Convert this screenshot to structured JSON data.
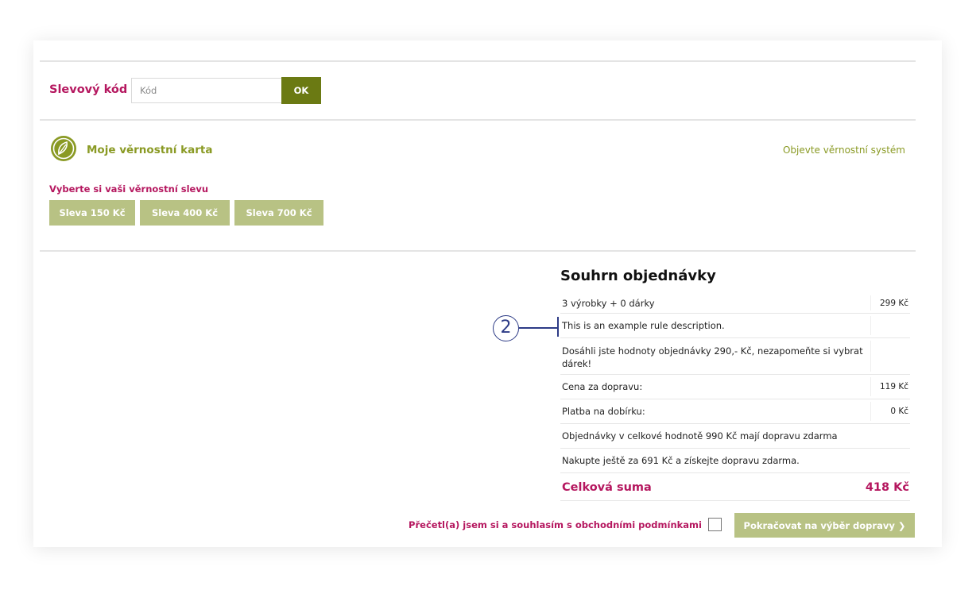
{
  "discount": {
    "label": "Slevový kód",
    "placeholder": "Kód",
    "ok_label": "OK"
  },
  "loyalty": {
    "title": "Moje věrnostní karta",
    "link": "Objevte věrnostní systém",
    "subtitle": "Vyberte si vaši věrnostní slevu",
    "buttons": [
      "Sleva 150 Kč",
      "Sleva 400 Kč",
      "Sleva 700 Kč"
    ],
    "icon": "leaf-icon"
  },
  "summary": {
    "title": "Souhrn objednávky",
    "rows": [
      {
        "text": "3 výrobky + 0 dárky",
        "value": "299 Kč"
      },
      {
        "text": "This is an example rule description.",
        "value": ""
      },
      {
        "text": "Dosáhli jste hodnoty objednávky 290,- Kč, nezapomeňte si vybrat dárek!",
        "value": ""
      },
      {
        "text": "Cena za dopravu:",
        "value": "119 Kč"
      },
      {
        "text": "Platba na dobírku:",
        "value": "0 Kč"
      },
      {
        "text": "Objednávky v celkové hodnotě 990 Kč mají dopravu zdarma",
        "value": ""
      },
      {
        "text": "Nakupte ještě za 691 Kč a získejte dopravu zdarma.",
        "value": ""
      }
    ],
    "total_label": "Celková suma",
    "total_value": "418 Kč"
  },
  "annotation": {
    "number": "2"
  },
  "terms": {
    "label": "Přečetl(a) jsem si a souhlasím s obchodními podmínkami",
    "checked": false
  },
  "continue_label": "Pokračovat na výběr dopravy ❯",
  "colors": {
    "brand_magenta": "#b5175f",
    "brand_olive": "#6b7a13",
    "loyalty_green": "#8a9a24",
    "button_light": "#b8c284",
    "annotation_blue": "#2d3b86"
  }
}
